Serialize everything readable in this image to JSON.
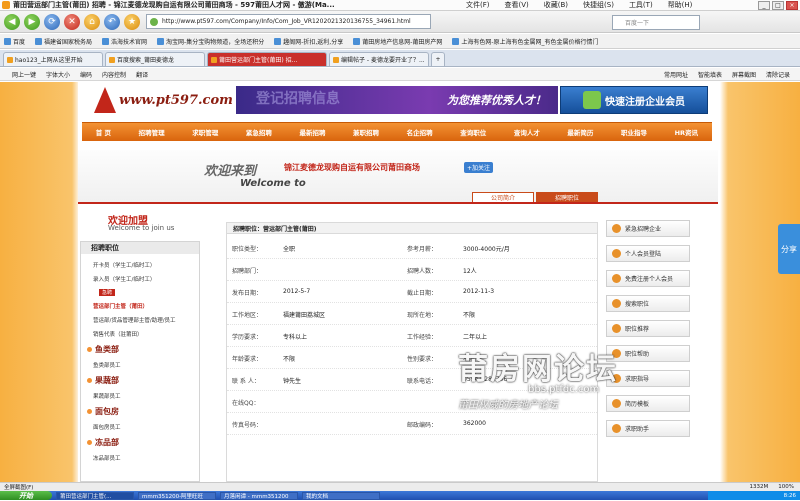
{
  "window": {
    "title": "莆田营运部门主管(莆田) 招聘 - 锦江麦德龙现购自运有限公司莆田商场 - 597莆田人才网 - 傲游(Ma...",
    "menus": [
      "文件(F)",
      "查看(V)",
      "收藏(B)",
      "快捷组(S)",
      "工具(T)",
      "帮助(H)"
    ]
  },
  "navbar": {
    "url": "http://www.pt597.com/Company/Info/Com_Job_VR1202021320136755_34961.html",
    "search_placeholder": "百度一下"
  },
  "bookmarks": [
    "百度",
    "福建省国家税务局",
    "浩海技术官网",
    "淘宝网-集分宝购物频道，全场还积分",
    "趣阁网-折扣,返利,分享",
    "莆田房地产信息网-莆田房产网",
    "上海有色网-原上海有色金属网_有色金属价格行情门"
  ],
  "tabs": [
    {
      "label": "hao123_上网从这里开始"
    },
    {
      "label": "百度搜索_莆田麦德龙"
    },
    {
      "label": "莆田营运部门主管(莆田) 招..."
    },
    {
      "label": "编辑帖子 - 麦德龙要开业了？..."
    }
  ],
  "toolbar2": {
    "items": [
      "网上一键",
      "字体大小",
      "编码",
      "内容控制",
      "翻译"
    ],
    "right_items": [
      "常用网址",
      "智能填表",
      "屏幕截图",
      "清除记录"
    ]
  },
  "site": {
    "logo_text": "www.pt597.com",
    "ad_faint": "登记招聘信息",
    "ad_slogan": "为您推荐优秀人才！",
    "register_button": "快速注册企业会员",
    "nav": [
      "首 页",
      "招聘管理",
      "求职管理",
      "紧急招聘",
      "最新招聘",
      "兼职招聘",
      "名企招聘",
      "查询职位",
      "查询人才",
      "最新简历",
      "职业指导",
      "HR资讯"
    ]
  },
  "welcome": {
    "title": "欢迎来到",
    "subtitle": "Welcome to",
    "company": "锦江麦德龙现购自运有限公司莆田商场",
    "follow": "+加关注",
    "tabs": [
      "公司简介",
      "招聘职位"
    ]
  },
  "sidebar": {
    "join_title": "欢迎加盟",
    "join_sub": "Welcome to join us",
    "cat_header": "招聘职位",
    "urgent_label": "急聘",
    "items": [
      {
        "type": "item",
        "text": "开卡员（学生工/临时工）"
      },
      {
        "type": "item",
        "text": "录入员（学生工/临时工）"
      },
      {
        "type": "urgent"
      },
      {
        "type": "current",
        "text": "营运部门主管（莆田）"
      },
      {
        "type": "item",
        "text": "营运部/货品管理部主管/助理/员工"
      },
      {
        "type": "item",
        "text": "销售代表（驻莆田）"
      },
      {
        "type": "group",
        "text": "鱼类部"
      },
      {
        "type": "item",
        "text": "鱼类部员工"
      },
      {
        "type": "group",
        "text": "果蔬部"
      },
      {
        "type": "item",
        "text": "果蔬部员工"
      },
      {
        "type": "group",
        "text": "面包房"
      },
      {
        "type": "item",
        "text": "面包房员工"
      },
      {
        "type": "group",
        "text": "冻品部"
      },
      {
        "type": "item",
        "text": "冻品部员工"
      }
    ]
  },
  "detail": {
    "header": "招聘职位：营运部门主管(莆田)",
    "rows": [
      {
        "k1": "职位类型：",
        "v1": "全职",
        "k2": "参考月薪：",
        "v2": "3000-4000元/月"
      },
      {
        "k1": "招聘部门：",
        "v1": "",
        "k2": "招聘人数：",
        "v2": "12人"
      },
      {
        "k1": "发布日期：",
        "v1": "2012-5-7",
        "k2": "截止日期：",
        "v2": "2012-11-3"
      },
      {
        "k1": "工作地区：",
        "v1": "福建莆田荔城区",
        "k2": "现所在地：",
        "v2": "不限"
      },
      {
        "k1": "学历要求：",
        "v1": "专科以上",
        "k2": "工作经验：",
        "v2": "二年以上"
      },
      {
        "k1": "年龄要求：",
        "v1": "不限",
        "k2": "性别要求：",
        "v2": "不限"
      },
      {
        "k1": "联 系 人：",
        "v1": "钟先生",
        "k2": "联系电话：",
        "v2": "0594-2287706"
      },
      {
        "k1": "在线QQ：",
        "v1": "",
        "k2": "",
        "v2": ""
      },
      {
        "k1": "传真号码：",
        "v1": "",
        "k2": "邮政编码：",
        "v2": "362000"
      }
    ]
  },
  "rightbar": [
    "紧急招聘企业",
    "个人会员登陆",
    "免费注册个人会员",
    "搜索职位",
    "职位推荐",
    "职位帮助",
    "求职指导",
    "简历模板",
    "求职助手"
  ],
  "watermark": {
    "line1": "莆房网论坛",
    "line2": "bbs.ptfdc.com",
    "line3": "莆田权威的房地产论坛"
  },
  "share": "分享",
  "statusbar": {
    "left": "全屏截图(F)",
    "right": [
      "1332M",
      "100%"
    ]
  },
  "taskbar": {
    "start": "开始",
    "tasks": [
      "莆田营运部门主管(...",
      "mmm351200-阿里旺旺",
      "月落闲谭 - mmm351200",
      "我的文档"
    ],
    "clock": "8:26"
  }
}
